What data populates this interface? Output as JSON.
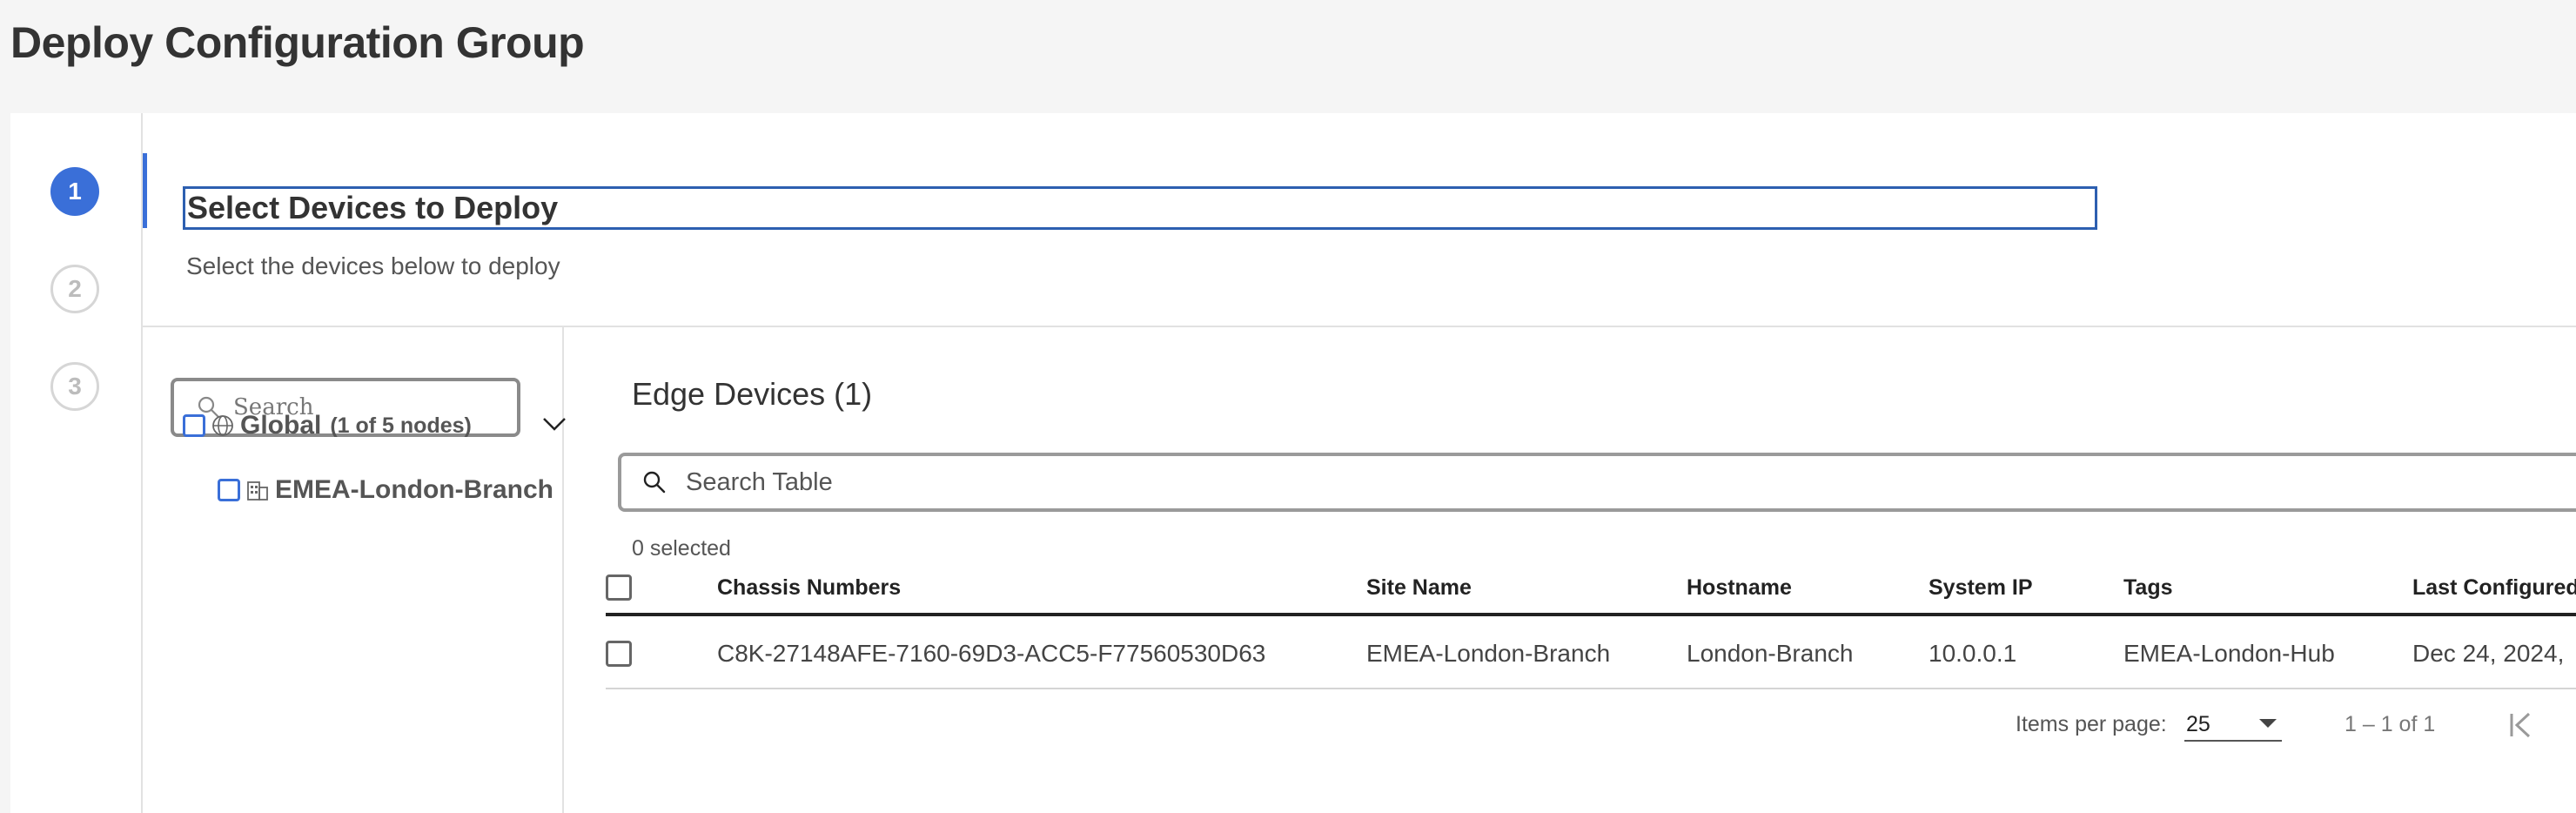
{
  "page": {
    "title": "Deploy Configuration Group"
  },
  "steps": [
    {
      "number": "1",
      "state": "active"
    },
    {
      "number": "2",
      "state": "inactive"
    },
    {
      "number": "3",
      "state": "inactive"
    }
  ],
  "step_header": {
    "title": "Select Devices to Deploy",
    "subtitle": "Select the devices below to deploy"
  },
  "tree": {
    "search_placeholder": "Search",
    "root": {
      "label": "Global",
      "count": "(1 of 5 nodes)",
      "icon": "globe-icon",
      "expanded": true
    },
    "children": [
      {
        "label": "EMEA-London-Branch",
        "icon": "building-icon"
      }
    ]
  },
  "table": {
    "title": "Edge Devices (1)",
    "search_placeholder": "Search Table",
    "selected_text": "0 selected",
    "columns": [
      "Chassis Numbers",
      "Site Name",
      "Hostname",
      "System IP",
      "Tags",
      "Last Configured"
    ],
    "rows": [
      {
        "chassis": "C8K-27148AFE-7160-69D3-ACC5-F77560530D63",
        "site": "EMEA-London-Branch",
        "hostname": "London-Branch",
        "system_ip": "10.0.0.1",
        "tags": "EMEA-London-Hub",
        "last_configured": "Dec 24, 2024,"
      }
    ]
  },
  "pagination": {
    "items_per_page_label": "Items per page:",
    "items_per_page_value": "25",
    "range": "1 – 1 of 1"
  },
  "colors": {
    "accent": "#3a6fd8",
    "title_border": "#2d5fb0"
  }
}
